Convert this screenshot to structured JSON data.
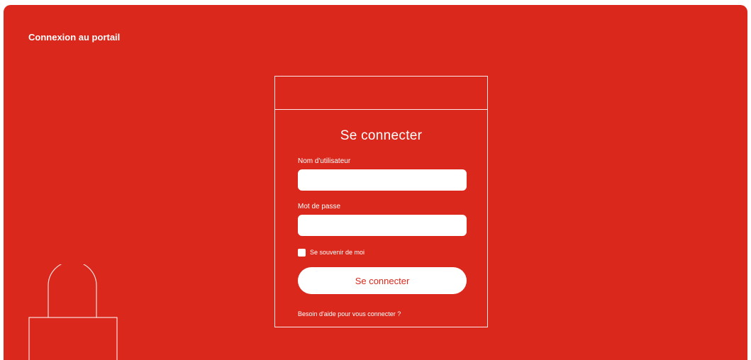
{
  "colors": {
    "brand_red": "#da291c",
    "white": "#ffffff"
  },
  "header": {
    "title": "Connexion au portail"
  },
  "illustration": {
    "icon": "padlock-outline-icon"
  },
  "login_form": {
    "title": "Se connecter",
    "username": {
      "label": "Nom d'utilisateur",
      "value": "",
      "placeholder": ""
    },
    "password": {
      "label": "Mot de passe",
      "value": "",
      "placeholder": ""
    },
    "remember_me": {
      "label": "Se souvenir de moi",
      "checked": false
    },
    "submit_label": "Se connecter",
    "help_link": "Besoin d'aide pour vous connecter ?"
  }
}
